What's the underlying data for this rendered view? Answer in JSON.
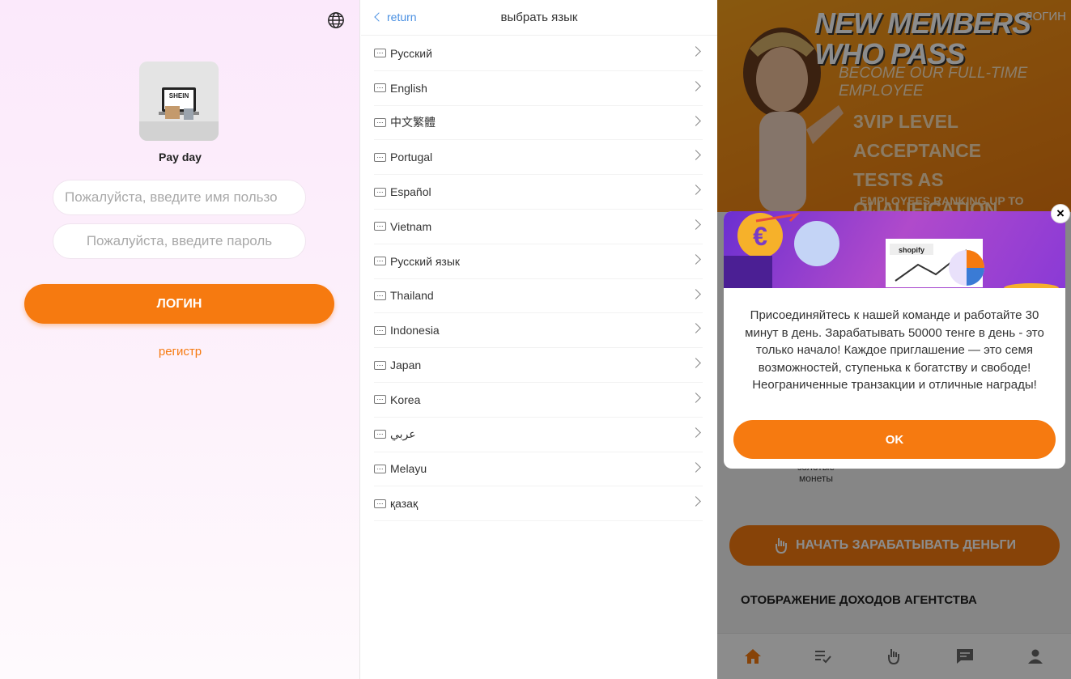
{
  "login": {
    "app_name": "Pay day",
    "logo_text": "SHEIN",
    "username_placeholder": "Пожалуйста, введите имя пользо",
    "password_placeholder": "Пожалуйста, введите пароль",
    "login_button": "ЛОГИН",
    "register_link": "регистр"
  },
  "language_picker": {
    "back_label": "return",
    "title": "выбрать язык",
    "languages": [
      "Русский",
      "English",
      "中文繁體",
      "Portugal",
      "Español",
      "Vietnam",
      "Русский язык",
      "Thailand",
      "Indonesia",
      "Japan",
      "Korea",
      "عربي",
      "Melayu",
      "қазақ"
    ]
  },
  "home": {
    "login_top": "ЛОГИН",
    "banner": {
      "headline_1": "NEW MEMBERS",
      "headline_2": "WHO PASS",
      "sub_1": "BECOME OUR FULL-TIME",
      "sub_2": "EMPLOYEE",
      "promo_1": "3VIP LEVEL ACCEPTANCE",
      "promo_2": "TESTS AS QUALIFICATION",
      "footer": "EMPLOYEES RANKING UP TO 10LEVEL"
    },
    "below_labels": {
      "coins_1": "золотые",
      "coins_2": "монеты"
    },
    "earn_button": "НАЧАТЬ ЗАРАБАТЫВАТЬ ДЕНЬГИ",
    "agency_title": "ОТОБРАЖЕНИЕ ДОХОДОВ АГЕНТСТВА",
    "modal": {
      "image_brand": "shopify",
      "message": "Присоединяйтесь к нашей команде и работайте 30 минут в день. Зарабатывать 50000 тенге в день - это только начало! Каждое приглашение — это семя возможностей, ступенька к богатству и свободе! Неограниченные транзакции и отличные награды!",
      "ok_button": "OK",
      "close_glyph": "×"
    }
  },
  "colors": {
    "accent": "#f67a10",
    "link_blue": "#4a90e2",
    "banner_orange": "#f38c15"
  }
}
